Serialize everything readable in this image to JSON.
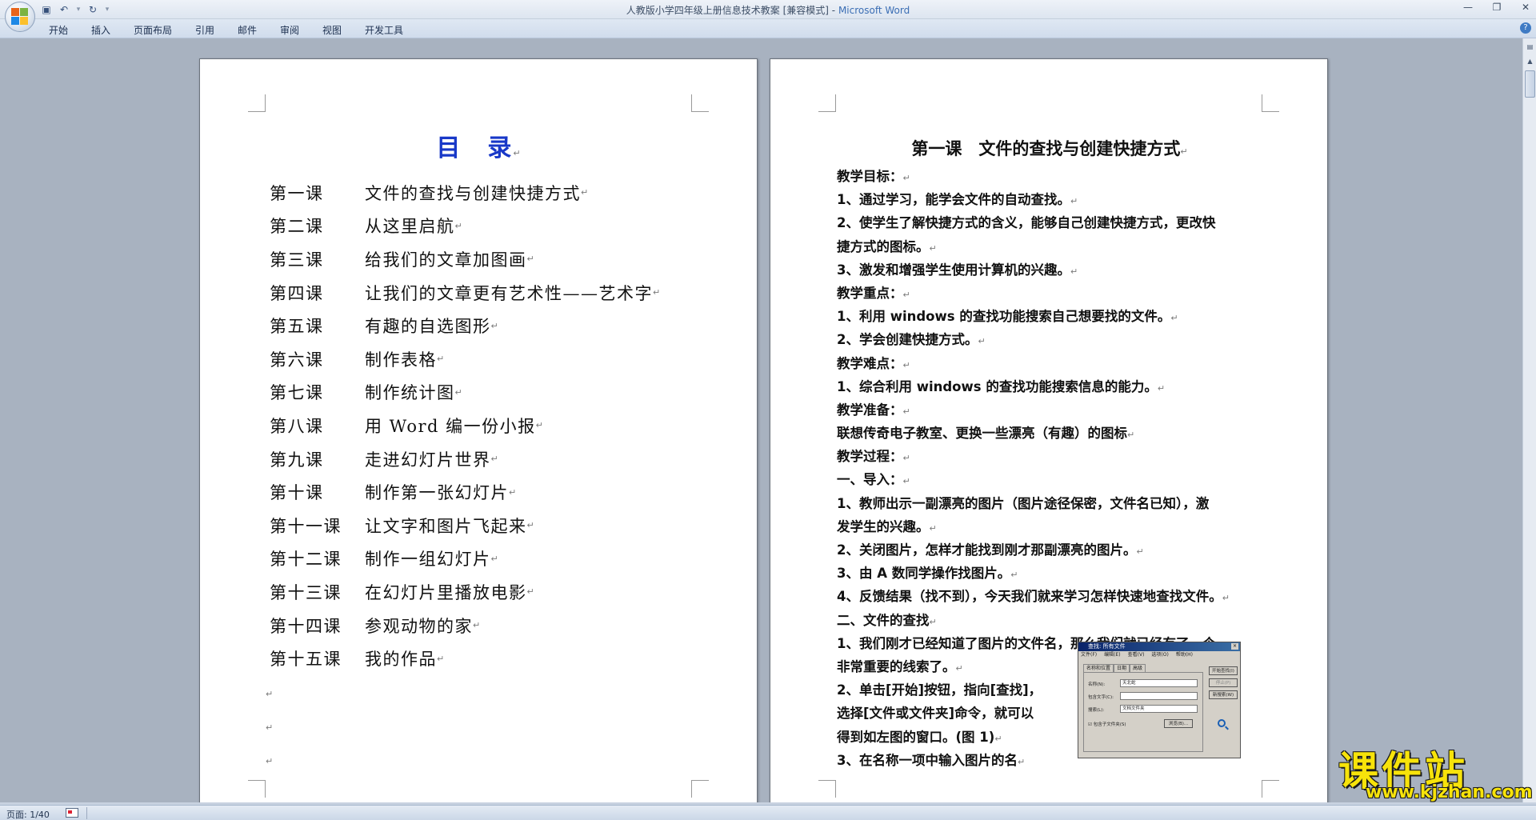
{
  "window": {
    "title": "人教版小学四年级上册信息技术教案 [兼容模式]",
    "separator": " - ",
    "app_name": "Microsoft Word"
  },
  "ribbon": {
    "tabs": [
      "开始",
      "插入",
      "页面布局",
      "引用",
      "邮件",
      "审阅",
      "视图",
      "开发工具"
    ]
  },
  "toc": {
    "title": "目　录",
    "items": [
      {
        "num": "第一课",
        "name": "文件的查找与创建快捷方式"
      },
      {
        "num": "第二课",
        "name": "从这里启航"
      },
      {
        "num": "第三课",
        "name": "给我们的文章加图画"
      },
      {
        "num": "第四课",
        "name": "让我们的文章更有艺术性——艺术字"
      },
      {
        "num": "第五课",
        "name": "有趣的自选图形"
      },
      {
        "num": "第六课",
        "name": "制作表格"
      },
      {
        "num": "第七课",
        "name": "制作统计图"
      },
      {
        "num": "第八课",
        "name": "用 Word 编一份小报"
      },
      {
        "num": "第九课",
        "name": "走进幻灯片世界"
      },
      {
        "num": "第十课",
        "name": "制作第一张幻灯片"
      },
      {
        "num": "第十一课",
        "name": "让文字和图片飞起来"
      },
      {
        "num": "第十二课",
        "name": "制作一组幻灯片"
      },
      {
        "num": "第十三课",
        "name": "在幻灯片里播放电影"
      },
      {
        "num": "第十四课",
        "name": "参观动物的家"
      },
      {
        "num": "第十五课",
        "name": "我的作品"
      }
    ]
  },
  "lesson": {
    "title": "第一课　文件的查找与创建快捷方式",
    "lines": [
      "教学目标：",
      "1、通过学习，能学会文件的自动查找。",
      "2、使学生了解快捷方式的含义，能够自己创建快捷方式，更改快",
      "捷方式的图标。",
      "3、激发和增强学生使用计算机的兴趣。",
      "教学重点：",
      "1、利用 windows 的查找功能搜索自己想要找的文件。",
      "2、学会创建快捷方式。",
      "教学难点：",
      "1、综合利用 windows 的查找功能搜索信息的能力。",
      "教学准备：",
      "联想传奇电子教室、更换一些漂亮（有趣）的图标",
      "教学过程：",
      "一、导入：",
      "1、教师出示一副漂亮的图片（图片途径保密，文件名已知），激",
      "发学生的兴趣。",
      "2、关闭图片，怎样才能找到刚才那副漂亮的图片。",
      "3、由 A 数同学操作找图片。",
      "4、反馈结果（找不到），今天我们就来学习怎样快速地查找文件。",
      "二、文件的查找",
      "1、我们刚才已经知道了图片的文件名，那么我们就已经有了一个",
      "非常重要的线索了。",
      "2、单击[开始]按钮，指向[查找]，",
      "选择[文件或文件夹]命令，就可以",
      "得到如左图的窗口。(图 1)",
      "3、在名称一项中输入图片的名"
    ]
  },
  "dialog": {
    "title": "查找: 所有文件",
    "menu": [
      "文件(F)",
      "编辑(E)",
      "查看(V)",
      "选项(O)",
      "帮助(H)"
    ],
    "tabs": [
      "名称和位置",
      "日期",
      "高级"
    ],
    "name_label": "名称(N):",
    "name_value": "天北蛇",
    "content_label": "包含文字(C):",
    "lookin_label": "搜索(L):",
    "lookin_value": "文档文件夹",
    "subfolder_label": "包含子文件夹(S)",
    "browse": "浏览(B)...",
    "find_now": "开始查找(I)",
    "stop": "停止(P)",
    "new_search": "新搜索(W)"
  },
  "status": {
    "page": "页面: 1/40"
  },
  "watermark": {
    "cn": "课件站",
    "url": "www.kjzhan.com"
  }
}
